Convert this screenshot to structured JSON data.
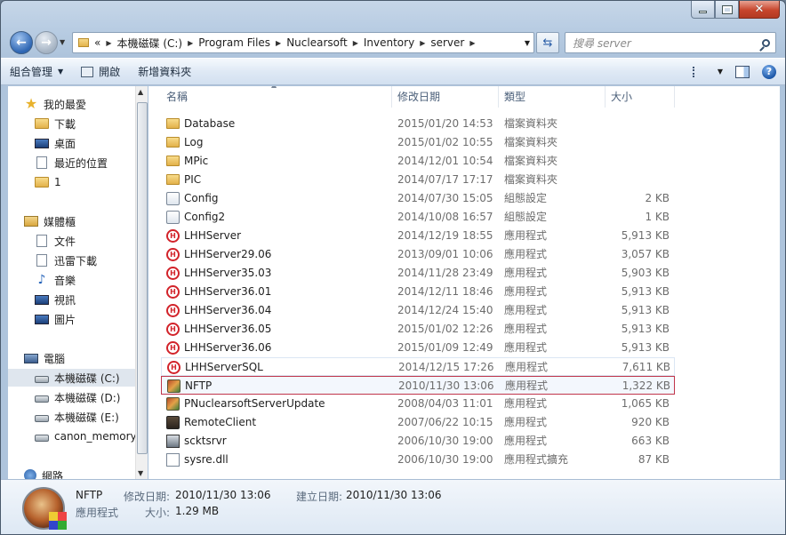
{
  "address": {
    "overflow": "«",
    "crumbs": [
      "本機磁碟 (C:)",
      "Program Files",
      "Nuclearsoft",
      "Inventory",
      "server"
    ]
  },
  "search": {
    "placeholder": "搜尋 server"
  },
  "toolbar": {
    "organize_label": "組合管理",
    "open_label": "開啟",
    "new_folder_label": "新增資料夾"
  },
  "nav": {
    "favorites": {
      "label": "我的最愛",
      "items": [
        "下載",
        "桌面",
        "最近的位置",
        "1"
      ]
    },
    "libraries": {
      "label": "媒體櫃",
      "items": [
        "文件",
        "迅雷下載",
        "音樂",
        "視訊",
        "圖片"
      ]
    },
    "computer": {
      "label": "電腦",
      "items": [
        "本機磁碟 (C:)",
        "本機磁碟 (D:)",
        "本機磁碟 (E:)",
        "canon_memory"
      ]
    },
    "network": {
      "label": "網路"
    }
  },
  "columns": {
    "name": "名稱",
    "date": "修改日期",
    "type": "類型",
    "size": "大小"
  },
  "files": [
    {
      "name": "Database",
      "date": "2015/01/20 14:53",
      "type": "檔案資料夾",
      "size": "",
      "icon": "folder-icon"
    },
    {
      "name": "Log",
      "date": "2015/01/02 10:55",
      "type": "檔案資料夾",
      "size": "",
      "icon": "folder-icon"
    },
    {
      "name": "MPic",
      "date": "2014/12/01 10:54",
      "type": "檔案資料夾",
      "size": "",
      "icon": "folder-icon"
    },
    {
      "name": "PIC",
      "date": "2014/07/17 17:17",
      "type": "檔案資料夾",
      "size": "",
      "icon": "folder-icon"
    },
    {
      "name": "Config",
      "date": "2014/07/30 15:05",
      "type": "組態設定",
      "size": "2 KB",
      "icon": "config-file-icon"
    },
    {
      "name": "Config2",
      "date": "2014/10/08 16:57",
      "type": "組態設定",
      "size": "1 KB",
      "icon": "config-file-icon"
    },
    {
      "name": "LHHServer",
      "date": "2014/12/19 18:55",
      "type": "應用程式",
      "size": "5,913 KB",
      "icon": "lhh-app-icon"
    },
    {
      "name": "LHHServer29.06",
      "date": "2013/09/01 10:06",
      "type": "應用程式",
      "size": "3,057 KB",
      "icon": "lhh-app-icon"
    },
    {
      "name": "LHHServer35.03",
      "date": "2014/11/28 23:49",
      "type": "應用程式",
      "size": "5,903 KB",
      "icon": "lhh-app-icon"
    },
    {
      "name": "LHHServer36.01",
      "date": "2014/12/11 18:46",
      "type": "應用程式",
      "size": "5,913 KB",
      "icon": "lhh-app-icon"
    },
    {
      "name": "LHHServer36.04",
      "date": "2014/12/24 15:40",
      "type": "應用程式",
      "size": "5,913 KB",
      "icon": "lhh-app-icon"
    },
    {
      "name": "LHHServer36.05",
      "date": "2015/01/02 12:26",
      "type": "應用程式",
      "size": "5,913 KB",
      "icon": "lhh-app-icon"
    },
    {
      "name": "LHHServer36.06",
      "date": "2015/01/09 12:49",
      "type": "應用程式",
      "size": "5,913 KB",
      "icon": "lhh-app-icon"
    },
    {
      "name": "LHHServerSQL",
      "date": "2014/12/15 17:26",
      "type": "應用程式",
      "size": "7,611 KB",
      "icon": "lhh-app-icon"
    },
    {
      "name": "NFTP",
      "date": "2010/11/30 13:06",
      "type": "應用程式",
      "size": "1,322 KB",
      "icon": "nftp-app-icon"
    },
    {
      "name": "PNuclearsoftServerUpdate",
      "date": "2008/04/03 11:01",
      "type": "應用程式",
      "size": "1,065 KB",
      "icon": "update-app-icon"
    },
    {
      "name": "RemoteClient",
      "date": "2007/06/22 10:15",
      "type": "應用程式",
      "size": "920 KB",
      "icon": "remote-app-icon"
    },
    {
      "name": "scktsrvr",
      "date": "2006/10/30 19:00",
      "type": "應用程式",
      "size": "663 KB",
      "icon": "socket-app-icon"
    },
    {
      "name": "sysre.dll",
      "date": "2006/10/30 19:00",
      "type": "應用程式擴充",
      "size": "87 KB",
      "icon": "dll-file-icon"
    }
  ],
  "selected_index": 14,
  "hover_index": 13,
  "details": {
    "name": "NFTP",
    "type": "應用程式",
    "modified_label": "修改日期:",
    "modified_value": "2010/11/30 13:06",
    "created_label": "建立日期:",
    "created_value": "2010/11/30 13:06",
    "size_label": "大小:",
    "size_value": "1.29 MB"
  },
  "colors": {
    "selection_border": "#c0354b",
    "app_icon_red": "#d2232a"
  }
}
